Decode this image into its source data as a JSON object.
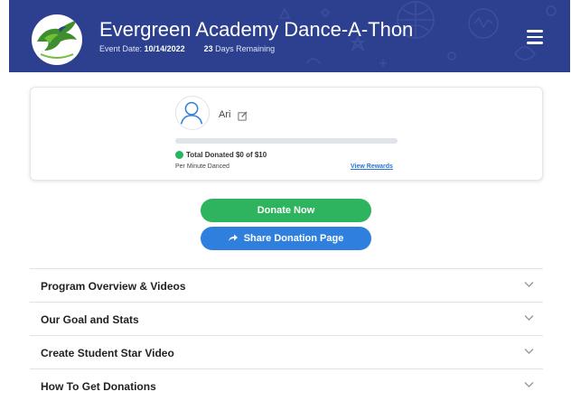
{
  "header": {
    "title": "Evergreen Academy Dance-A-Thon",
    "event_date_label": "Event Date:",
    "event_date": "10/14/2022",
    "days_count": "23",
    "days_label": "Days Remaining",
    "logo_text": "EVERGREEN ACADEMY",
    "bg_color": "#2d3f8f",
    "menu_icon": "hamburger-menu-icon"
  },
  "profile": {
    "name": "Ari",
    "total_donated": "Total Donated $0 of $10",
    "progress_fraction": 0,
    "per_minute": "Per Minute Danced",
    "view_rewards": "View Rewards"
  },
  "buttons": {
    "donate": "Donate Now",
    "share": "Share Donation Page",
    "donate_color": "#2eb45e",
    "share_color": "#2f80de"
  },
  "sections": [
    {
      "label": "Program Overview & Videos"
    },
    {
      "label": "Our Goal and Stats"
    },
    {
      "label": "Create Student Star Video"
    },
    {
      "label": "How To Get Donations"
    }
  ]
}
